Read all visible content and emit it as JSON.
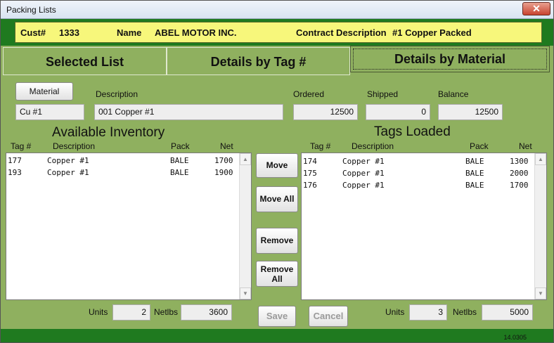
{
  "window": {
    "title": "Packing Lists",
    "close_glyph": "✕"
  },
  "header": {
    "cust_label": "Cust#",
    "cust_value": "1333",
    "name_label": "Name",
    "name_value": "ABEL MOTOR INC.",
    "contract_label": "Contract Description",
    "contract_value": "#1 Copper Packed"
  },
  "tabs": [
    {
      "label": "Selected List"
    },
    {
      "label": "Details by Tag #"
    },
    {
      "label": "Details by Material"
    }
  ],
  "material": {
    "button_label": "Material",
    "value": "Cu #1",
    "description_label": "Description",
    "description_value": "001 Copper #1",
    "ordered_label": "Ordered",
    "ordered_value": "12500",
    "shipped_label": "Shipped",
    "shipped_value": "0",
    "balance_label": "Balance",
    "balance_value": "12500"
  },
  "available": {
    "title": "Available Inventory",
    "columns": [
      "Tag #",
      "Description",
      "Pack",
      "Net"
    ],
    "rows": [
      {
        "tag": "177",
        "desc": "Copper #1",
        "pack": "BALE",
        "net": "1700"
      },
      {
        "tag": "193",
        "desc": "Copper #1",
        "pack": "BALE",
        "net": "1900"
      }
    ],
    "units_label": "Units",
    "units_value": "2",
    "netlbs_label": "Netlbs",
    "netlbs_value": "3600"
  },
  "loaded": {
    "title": "Tags Loaded",
    "columns": [
      "Tag #",
      "Description",
      "Pack",
      "Net"
    ],
    "rows": [
      {
        "tag": "174",
        "desc": "Copper #1",
        "pack": "BALE",
        "net": "1300"
      },
      {
        "tag": "175",
        "desc": "Copper #1",
        "pack": "BALE",
        "net": "2000"
      },
      {
        "tag": "176",
        "desc": "Copper #1",
        "pack": "BALE",
        "net": "1700"
      }
    ],
    "units_label": "Units",
    "units_value": "3",
    "netlbs_label": "Netlbs",
    "netlbs_value": "5000"
  },
  "actions": {
    "move": "Move",
    "move_all": "Move All",
    "remove": "Remove",
    "remove_all_line1": "Remove",
    "remove_all_line2": "All",
    "save": "Save",
    "cancel": "Cancel"
  },
  "status": {
    "version": "14.0305"
  },
  "icons": {
    "scroll_up": "▲",
    "scroll_down": "▼"
  },
  "colors": {
    "background": "#8fb05f",
    "header": "#f7f77b",
    "frame": "#1f7a1f"
  }
}
